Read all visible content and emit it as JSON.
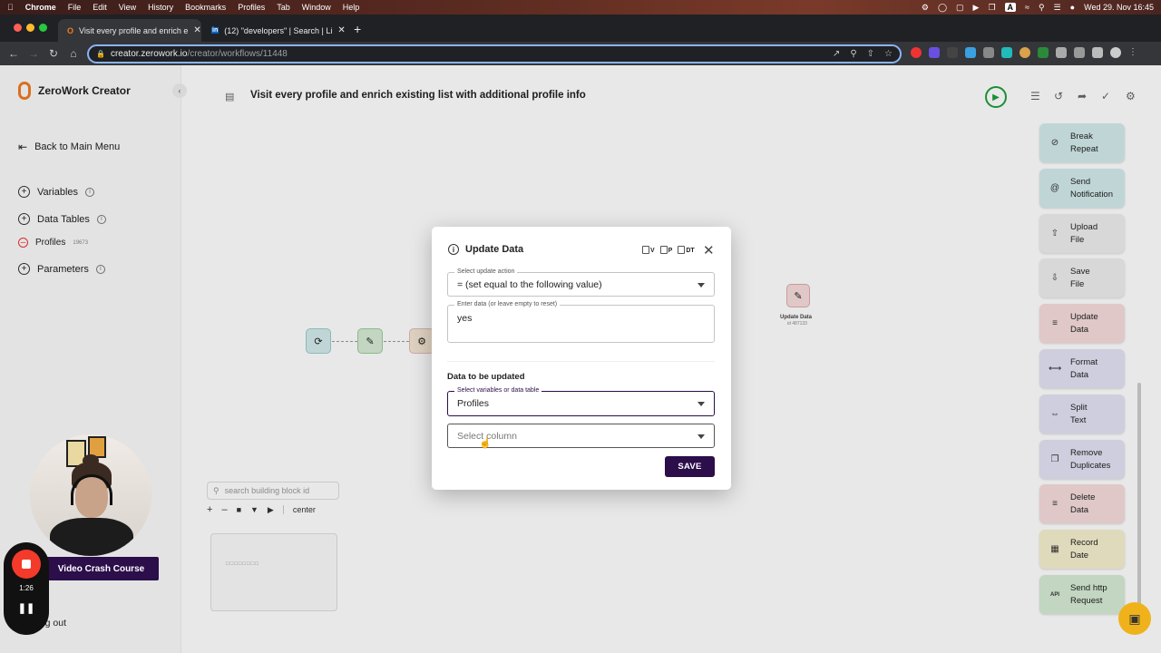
{
  "menubar": {
    "apple": "",
    "items": [
      "Chrome",
      "File",
      "Edit",
      "View",
      "History",
      "Bookmarks",
      "Profiles",
      "Tab",
      "Window",
      "Help"
    ],
    "datetime": "Wed 29. Nov  16:45",
    "a_badge": "A"
  },
  "browser": {
    "tabs": [
      {
        "label": "Visit every profile and enrich e",
        "icon": "zerowork-icon"
      },
      {
        "label": "(12) \"developers\" | Search | Li",
        "icon": "linkedin-icon"
      }
    ],
    "url_host": "creator.zerowork.io",
    "url_path": "/creator/workflows/11448"
  },
  "sidebar": {
    "app_name": "ZeroWork Creator",
    "back": "Back to Main Menu",
    "variables": "Variables",
    "data_tables": "Data Tables",
    "profiles": "Profiles",
    "profiles_id": "19673",
    "parameters": "Parameters",
    "logout": "Log out"
  },
  "workflow": {
    "title": "Visit every profile and enrich existing list with additional profile info",
    "canvas_node_label": "Update Data",
    "canvas_node_id": "id 487133",
    "search_placeholder": "search building block id",
    "center": "center"
  },
  "palette": [
    {
      "label": "Break Repeat",
      "icon": "break-icon",
      "color": "#d4ecec"
    },
    {
      "label": "Send Notification",
      "icon": "at-icon",
      "color": "#d4ecec"
    },
    {
      "label": "Upload File",
      "icon": "upload-icon",
      "color": "#e6e6e6"
    },
    {
      "label": "Save File",
      "icon": "download-icon",
      "color": "#e6e6e6"
    },
    {
      "label": "Update Data",
      "icon": "update-icon",
      "color": "#f7dcdc"
    },
    {
      "label": "Format Data",
      "icon": "format-icon",
      "color": "#e3e3f5"
    },
    {
      "label": "Split Text",
      "icon": "split-icon",
      "color": "#e3e3f5"
    },
    {
      "label": "Remove Duplicates",
      "icon": "dedupe-icon",
      "color": "#e3e3f5"
    },
    {
      "label": "Delete Data",
      "icon": "delete-icon",
      "color": "#f7dcdc"
    },
    {
      "label": "Record Date",
      "icon": "calendar-icon",
      "color": "#f6f0cf"
    },
    {
      "label": "Send http Request",
      "icon": "api-icon",
      "color": "#d6ecd6"
    }
  ],
  "modal": {
    "title": "Update Data",
    "tools": [
      "V",
      "P",
      "DT"
    ],
    "action_label": "Select update action",
    "action_value": "= (set equal to the following value)",
    "data_label": "Enter data (or leave empty to reset)",
    "data_value": "yes",
    "section": "Data to be updated",
    "table_label": "Select variables or data table",
    "table_value": "Profiles",
    "column_placeholder": "Select column",
    "save": "SAVE"
  },
  "webcam": {
    "banner": "Video Crash Course",
    "timer": "1:26"
  },
  "colors": {
    "brand": "#2b0e4a",
    "accent": "#f07b22",
    "run": "#1f9d3a"
  }
}
